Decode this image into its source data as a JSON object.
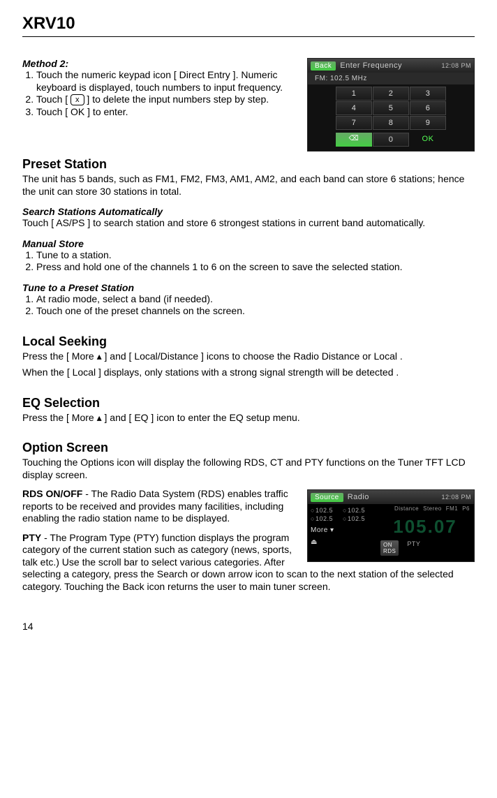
{
  "title": "XRV10",
  "method2": {
    "heading": "Method 2:",
    "items": [
      "Touch the numeric keypad icon [ Direct Entry ]. Numeric keyboard is displayed, touch numbers to input frequency.",
      "Touch [ ⌫ ] to delete the input numbers step by step.",
      "Touch [ OK ] to enter."
    ],
    "keybox": "x"
  },
  "keypad": {
    "back": "Back",
    "title": "Enter Frequency",
    "clock": "12:08 PM",
    "fm_line": "FM:   102.5  MHz",
    "keys": [
      "1",
      "2",
      "3",
      "4",
      "5",
      "6",
      "7",
      "8",
      "9"
    ],
    "del": "⌫",
    "zero": "0",
    "ok": "OK"
  },
  "preset": {
    "heading": "Preset Station",
    "body": "The unit has 5 bands, such as FM1, FM2, FM3, AM1, AM2, and each band can store 6 stations; hence the unit can store 30 stations in total.",
    "auto_h": "Search Stations Automatically",
    "auto_b": "Touch [ AS/PS ] to search station and store 6 strongest stations in current band automatically.",
    "manual_h": "Manual Store",
    "manual_items": [
      "Tune to a station.",
      "Press and hold one of the channels 1 to 6 on the screen to save the selected station."
    ],
    "tune_h": "Tune to a Preset Station",
    "tune_items": [
      "At radio mode, select a band (if needed).",
      "Touch one of the preset channels on the screen."
    ]
  },
  "local": {
    "heading": "Local Seeking",
    "line1": "Press the [ More ▴ ] and [ Local/Distance ] icons to choose the Radio Distance or Local .",
    "line2": "When the [ Local ] displays, only stations with a strong signal strength will be detected ."
  },
  "eq": {
    "heading": "EQ Selection",
    "body": "Press the [ More ▴ ] and [ EQ ] icon to enter the EQ setup menu."
  },
  "option": {
    "heading": "Option Screen",
    "intro": "Touching the Options icon will display the following RDS, CT and PTY functions on the Tuner TFT LCD display screen.",
    "rds_label": "RDS ON/OFF",
    "rds_body": " - The Radio Data System (RDS) enables traffic reports to be received and provides many facilities, including enabling the radio station name to be displayed.",
    "pty_label": "PTY",
    "pty_body": " - The Program Type (PTY) function displays the program category of the current station such as category (news, sports, talk etc.) Use the scroll bar to select various categories. After selecting a category, press the Search or down arrow icon to scan to the next station of the selected category. Touching the Back icon returns the user to main tuner screen."
  },
  "radioshot": {
    "src": "Source",
    "title": "Radio",
    "clock": "12:08 PM",
    "meta": [
      "Distance",
      "Stereo",
      "FM1",
      "P6"
    ],
    "presets": [
      "102.5",
      "102.5",
      "102.5",
      "102.5"
    ],
    "more": "More ▾",
    "rds": "ON\nRDS",
    "pty": "PTY",
    "bigfreq": "105.07"
  },
  "page": "14"
}
